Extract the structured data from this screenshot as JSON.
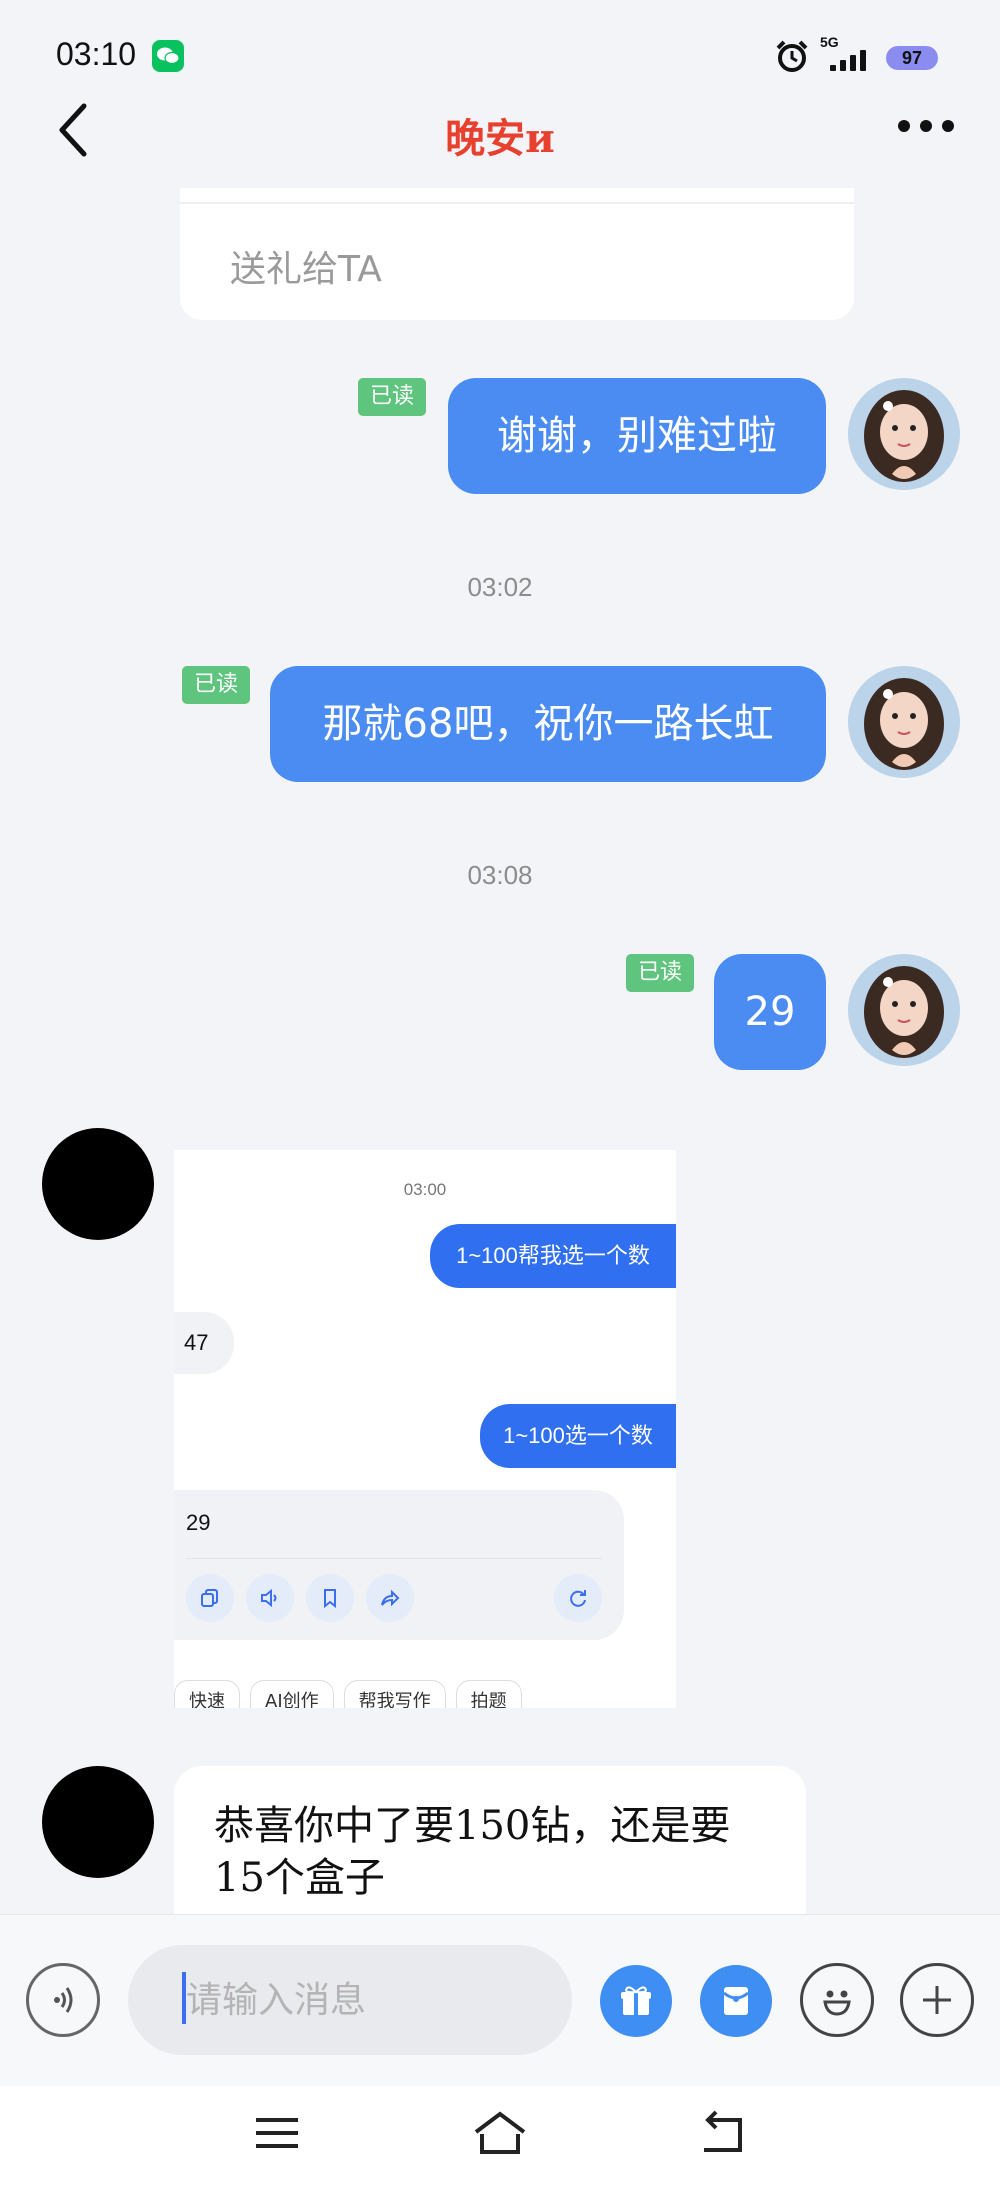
{
  "status_bar": {
    "time": "03:10",
    "network": "5G",
    "battery": "97"
  },
  "header": {
    "title": "晚安и"
  },
  "gift_card": {
    "label": "送礼给TA"
  },
  "messages": [
    {
      "read_label": "已读",
      "text": "谢谢，别难过啦"
    },
    {
      "read_label": "已读",
      "text": "那就68吧，祝你一路长虹"
    },
    {
      "read_label": "已读",
      "text": "29"
    }
  ],
  "timestamps": [
    "03:02",
    "03:08"
  ],
  "screenshot_message": {
    "time": "03:00",
    "sent_1": "1~100帮我选一个数",
    "reply_1": "47",
    "sent_2": "1~100选一个数",
    "reply_2": "29",
    "chips": [
      "快速",
      "AI创作",
      "帮我写作",
      "拍题"
    ]
  },
  "incoming_text": {
    "text": "恭喜你中了要150钻，还是要15个盒子"
  },
  "input": {
    "placeholder": "请输入消息",
    "value": ""
  },
  "colors": {
    "accent_blue": "#4a8cf2",
    "read_badge": "#5fc47d",
    "title_red": "#e8402e"
  }
}
